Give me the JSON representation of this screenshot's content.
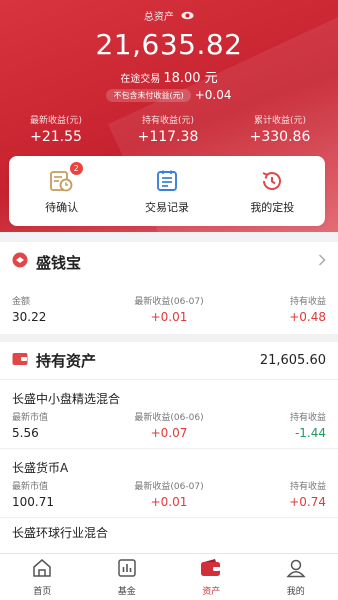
{
  "header": {
    "total_label": "总资产",
    "total_value": "21,635.82",
    "transit_label": "在途交易",
    "transit_value": "18.00 元",
    "uncleared_label": "不包含未付收益(元)",
    "uncleared_value": "+0.04"
  },
  "stats": [
    {
      "label": "最新收益(元)",
      "value": "+21.55"
    },
    {
      "label": "持有收益(元)",
      "value": "+117.38"
    },
    {
      "label": "累计收益(元)",
      "value": "+330.86"
    }
  ],
  "actions": [
    {
      "label": "待确认",
      "badge": "2",
      "icon": "pending-clock-icon"
    },
    {
      "label": "交易记录",
      "icon": "records-icon"
    },
    {
      "label": "我的定投",
      "icon": "fixed-investment-icon"
    }
  ],
  "shengqianbao": {
    "title": "盛钱宝",
    "col1_label": "金额",
    "col2_label": "最新收益(06-07)",
    "col3_label": "持有收益",
    "amount": "30.22",
    "latest": "+0.01",
    "holding": "+0.48"
  },
  "holdings": {
    "title": "持有资产",
    "total": "21,605.60",
    "funds": [
      {
        "name": "长盛中小盘精选混合",
        "col1_label": "最新市值",
        "col2_label": "最新收益(06-06)",
        "col3_label": "持有收益",
        "value": "5.56",
        "latest": "+0.07",
        "holding": "-1.44"
      },
      {
        "name": "长盛货币A",
        "col1_label": "最新市值",
        "col2_label": "最新收益(06-07)",
        "col3_label": "持有收益",
        "value": "100.71",
        "latest": "+0.01",
        "holding": "+0.74"
      },
      {
        "name": "长盛环球行业混合"
      }
    ]
  },
  "tabs": [
    {
      "label": "首页",
      "icon": "home-icon"
    },
    {
      "label": "基金",
      "icon": "fund-chart-icon"
    },
    {
      "label": "资产",
      "icon": "wallet-icon"
    },
    {
      "label": "我的",
      "icon": "user-icon"
    }
  ],
  "colors": {
    "brand_red": "#c6222f",
    "up": "#e03a3a",
    "down": "#1f9c5a"
  }
}
